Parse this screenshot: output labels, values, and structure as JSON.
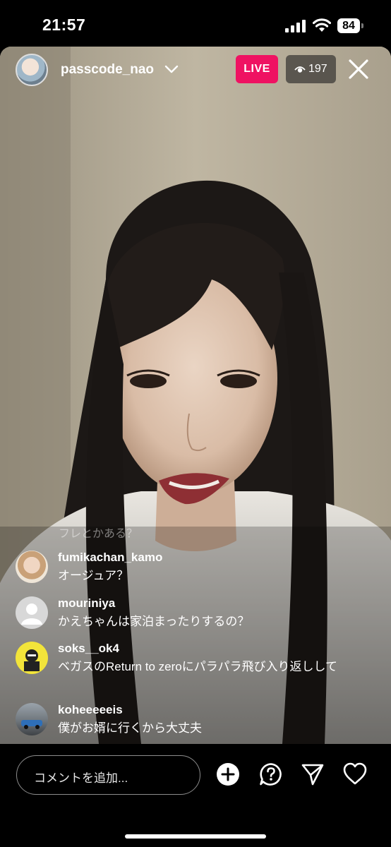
{
  "status_bar": {
    "time": "21:57",
    "battery": "84"
  },
  "header": {
    "host_name": "passcode_nao",
    "live_label": "LIVE",
    "viewer_count": "197"
  },
  "comments": {
    "faded": "フレとかある？",
    "items": [
      {
        "user": "fumikachan_kamo",
        "text": "オージュア？"
      },
      {
        "user": "mouriniya",
        "text": "かえちゃんは家泊まったりするの？"
      },
      {
        "user": "soks__ok4",
        "text": "ベガスのReturn to zeroにパラパラ飛び入り返しして"
      },
      {
        "user": "koheeeeeis",
        "text": "僕がお婿に行くから大丈夫"
      }
    ]
  },
  "bottom_bar": {
    "comment_placeholder": "コメントを追加..."
  },
  "colors": {
    "live_badge": "#ef1262",
    "background": "#000000"
  },
  "icons": [
    "signal-icon",
    "wifi-icon",
    "battery-icon",
    "chevron-down-icon",
    "eye-icon",
    "close-icon",
    "add-icon",
    "question-icon",
    "send-icon",
    "heart-icon"
  ]
}
